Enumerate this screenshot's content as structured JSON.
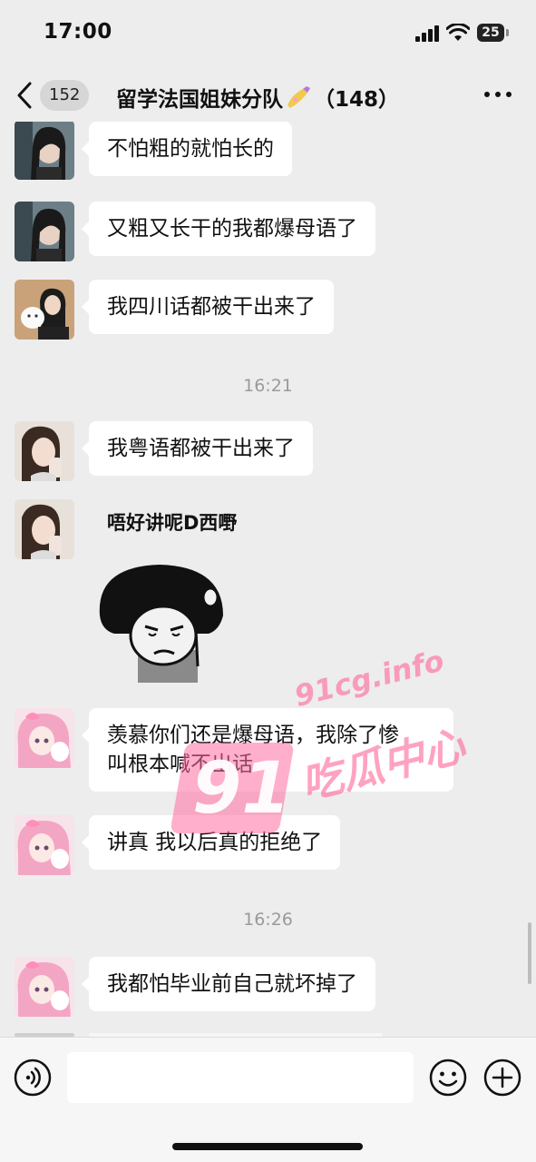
{
  "status_bar": {
    "time": "17:00",
    "battery": "25"
  },
  "nav": {
    "unread_count": "152",
    "title_before_icon": "留学法国姐妹分队",
    "title_after_icon": "（148）",
    "title_icon": "nail-polish-icon"
  },
  "messages": [
    {
      "type": "text",
      "avatar": "avatar-girl-dark-hair",
      "text": "不怕粗的就怕长的"
    },
    {
      "type": "text",
      "avatar": "avatar-girl-dark-hair",
      "text": "又粗又长干的我都爆母语了"
    },
    {
      "type": "text",
      "avatar": "avatar-girl-with-cat",
      "text": "我四川话都被干出来了"
    },
    {
      "type": "time",
      "text": "16:21"
    },
    {
      "type": "text",
      "avatar": "avatar-girl-selfie",
      "text": "我粤语都被干出来了"
    },
    {
      "type": "sticker",
      "avatar": "avatar-girl-selfie",
      "caption": "唔好讲呢D西嘢",
      "sticker": "mushroom-head-meme-icon"
    },
    {
      "type": "text",
      "avatar": "avatar-pink-anime",
      "lines": [
        "羡慕你们还是爆母语，我除了惨",
        "叫根本喊不出话"
      ]
    },
    {
      "type": "text",
      "avatar": "avatar-pink-anime",
      "text": "讲真 我以后真的拒绝了"
    },
    {
      "type": "time",
      "text": "16:26"
    },
    {
      "type": "text",
      "avatar": "avatar-pink-anime",
      "text": "我都怕毕业前自己就坏掉了"
    }
  ],
  "watermark": {
    "number": "91",
    "domain": "91cg.info",
    "chinese": "吃瓜中心"
  },
  "input": {
    "value": "",
    "placeholder": ""
  },
  "icons": {
    "back": "chevron-left-icon",
    "more": "more-dots-icon",
    "voice": "voice-icon",
    "emoji": "emoji-icon",
    "plus": "plus-icon"
  },
  "colors": {
    "background": "#ededed",
    "bubble": "#ffffff",
    "watermark_pink": "#ff6e9a"
  }
}
